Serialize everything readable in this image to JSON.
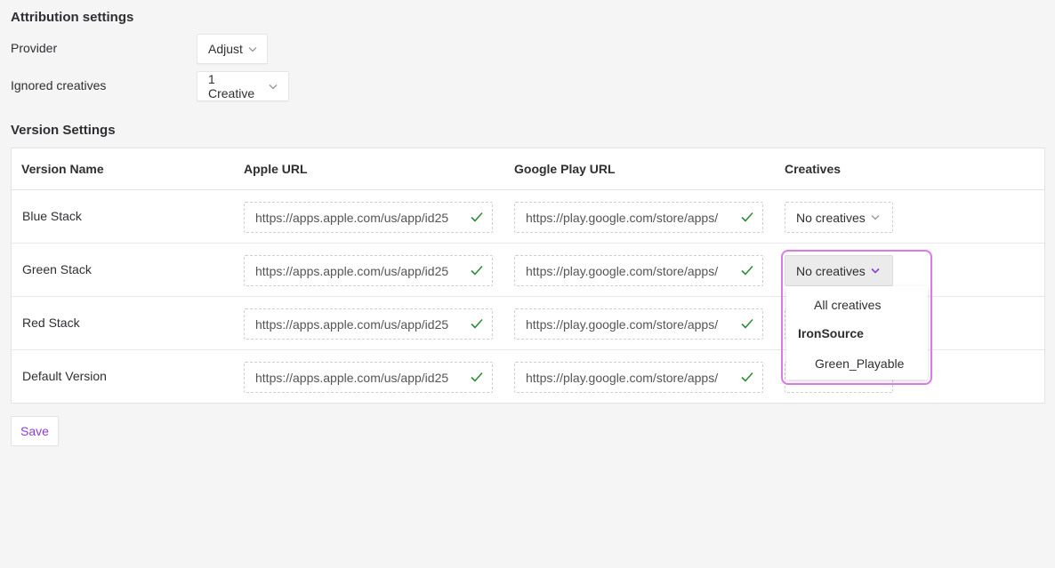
{
  "attribution": {
    "title": "Attribution settings",
    "provider_label": "Provider",
    "provider_value": "Adjust",
    "ignored_label": "Ignored creatives",
    "ignored_value": "1 Creative"
  },
  "versions": {
    "title": "Version Settings",
    "columns": [
      "Version Name",
      "Apple URL",
      "Google Play URL",
      "Creatives"
    ],
    "rows": [
      {
        "name": "Blue Stack",
        "apple_url": "https://apps.apple.com/us/app/id25",
        "google_url": "https://play.google.com/store/apps/",
        "creatives": "No creatives"
      },
      {
        "name": "Green Stack",
        "apple_url": "https://apps.apple.com/us/app/id25",
        "google_url": "https://play.google.com/store/apps/",
        "creatives": "No creatives"
      },
      {
        "name": "Red Stack",
        "apple_url": "https://apps.apple.com/us/app/id25",
        "google_url": "https://play.google.com/store/apps/",
        "creatives": ""
      },
      {
        "name": "Default Version",
        "apple_url": "https://apps.apple.com/us/app/id25",
        "google_url": "https://play.google.com/store/apps/",
        "creatives": ""
      }
    ]
  },
  "creatives_menu": {
    "all_label": "All creatives",
    "group_label": "IronSource",
    "options": [
      "Green_Playable"
    ]
  },
  "save_label": "Save",
  "colors": {
    "accent": "#8a3fd1",
    "highlight_outline": "#d77ce6",
    "check": "#2e8b3a"
  },
  "icons": {
    "dropdown": "chevron-down-icon",
    "valid": "check-icon"
  }
}
